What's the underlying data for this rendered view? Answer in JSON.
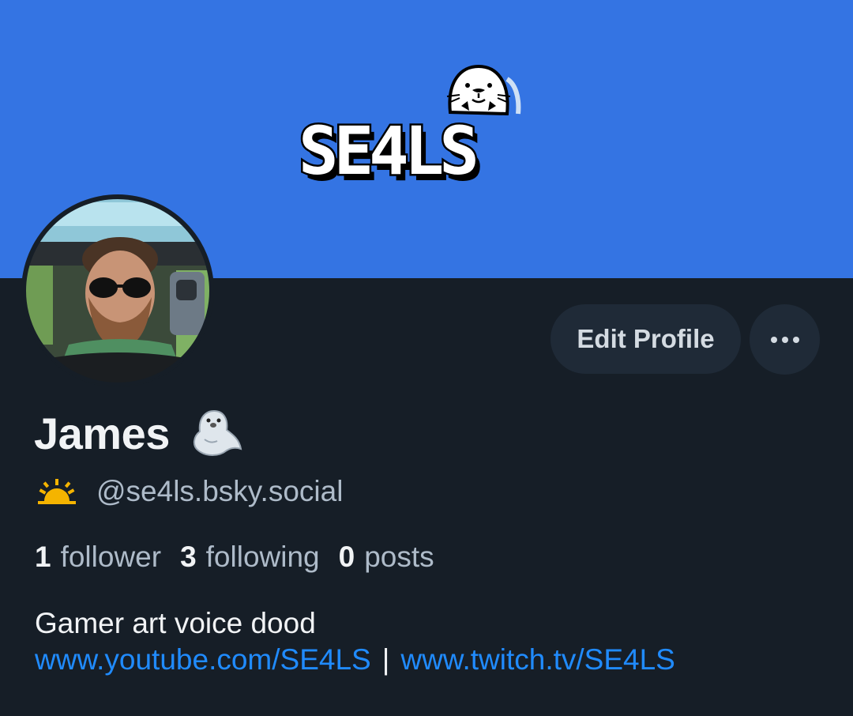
{
  "banner": {
    "color": "#3474e3",
    "logo_text": "SE4LS"
  },
  "avatar": {
    "description": "profile-photo"
  },
  "actions": {
    "edit_profile_label": "Edit Profile",
    "more_icon": "ellipsis-icon"
  },
  "profile": {
    "display_name": "James",
    "name_emoji": "seal-emoji",
    "handle_emoji": "sunrise-emoji",
    "handle": "@se4ls.bsky.social"
  },
  "stats": {
    "followers_count": "1",
    "followers_label": "follower",
    "following_count": "3",
    "following_label": "following",
    "posts_count": "0",
    "posts_label": "posts"
  },
  "bio": {
    "text": "Gamer art voice dood",
    "link1": "www.youtube.com/SE4LS",
    "separator": "|",
    "link2": "www.twitch.tv/SE4LS"
  },
  "colors": {
    "background": "#161e27",
    "button_bg": "#1f2a37",
    "link": "#208bfe",
    "muted_text": "#aebbc9"
  }
}
